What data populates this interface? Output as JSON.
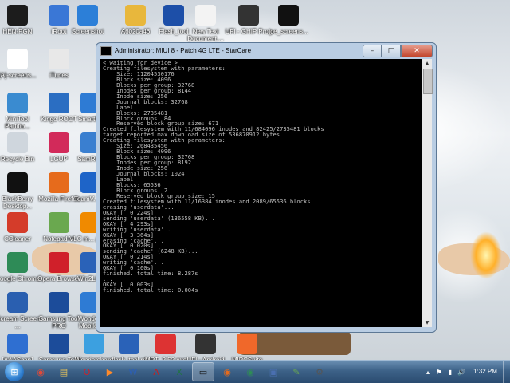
{
  "desktop_icons": [
    {
      "label": "HEN-PGN",
      "icon": "mobile-app-icon",
      "color": "#1c1c1c"
    },
    {
      "label": "iRoot",
      "icon": "root-app-icon",
      "color": "#3a77d6"
    },
    {
      "label": "Screenshot",
      "icon": "screenshot-icon",
      "color": "#2c7fd8"
    },
    {
      "label": "A6020a46",
      "icon": "folder-icon",
      "color": "#e8b73c"
    },
    {
      "label": "Flash_tool",
      "icon": "flash-tool-icon",
      "color": "#1d4fa8"
    },
    {
      "label": "New Text Document....",
      "icon": "text-document-icon",
      "color": "#f3f3f3"
    },
    {
      "label": "UFI - GHIP Prog",
      "icon": "ufi-icon",
      "color": "#333333"
    },
    {
      "label": "ice_screens...",
      "icon": "ice-screen-icon",
      "color": "#111111"
    },
    {
      "label": "[A]-screens...",
      "icon": "screenshot-file-icon",
      "color": "#ffffff"
    },
    {
      "label": "iTunes",
      "icon": "itunes-icon",
      "color": "#e8e8e8"
    },
    {
      "label": "MiniTool Partitio...",
      "icon": "minitool-icon",
      "color": "#3a8bd0"
    },
    {
      "label": "Kingo ROOT",
      "icon": "kingo-root-icon",
      "color": "#2b6ec2"
    },
    {
      "label": "SmartF...",
      "icon": "smartf-icon",
      "color": "#2e7bd4"
    },
    {
      "label": "Recycle Bin",
      "icon": "recycle-bin-icon",
      "color": "#cfd6dd"
    },
    {
      "label": "LGUP",
      "icon": "lgup-icon",
      "color": "#d22a5a"
    },
    {
      "label": "SamRe...",
      "icon": "samre-icon",
      "color": "#3a7fd0"
    },
    {
      "label": "BlackBerry Desktop...",
      "icon": "blackberry-icon",
      "color": "#111111"
    },
    {
      "label": "Mozilla Firefox",
      "icon": "firefox-icon",
      "color": "#e66b1c"
    },
    {
      "label": "TeamV... 12",
      "icon": "teamviewer-icon",
      "color": "#1e64c8"
    },
    {
      "label": "CCleaner",
      "icon": "ccleaner-icon",
      "color": "#d43c2a"
    },
    {
      "label": "Notepad++",
      "icon": "notepad-plus-icon",
      "color": "#6aa84f"
    },
    {
      "label": "VLC m... play...",
      "icon": "vlc-icon",
      "color": "#f08a00"
    },
    {
      "label": "Google Chrome",
      "icon": "chrome-icon",
      "color": "#2e8b57"
    },
    {
      "label": "Opera Browser",
      "icon": "opera-icon",
      "color": "#d0202a"
    },
    {
      "label": "Win2Lb...",
      "icon": "win2lb-icon",
      "color": "#2a62b8"
    },
    {
      "label": "iScream Screen ...",
      "icon": "screen-recorder-icon",
      "color": "#2a5fb0"
    },
    {
      "label": "Samsung Tool PRO",
      "icon": "samsung-tool-pro-icon",
      "color": "#1c4c9a"
    },
    {
      "label": "Wonde... Mobile...",
      "icon": "wondershare-mobile-icon",
      "color": "#2e7bd4"
    },
    {
      "label": "[AAAScan]",
      "icon": "scan-icon",
      "color": "#2f6fd1"
    },
    {
      "label": "Samsung Tool",
      "icon": "samsung-tool-icon",
      "color": "#1c4c9a"
    },
    {
      "label": "Wondershare TunesGo",
      "icon": "tunesgo-icon",
      "color": "#3ca0e0"
    },
    {
      "label": "flash_tool.rd",
      "icon": "flash-file-icon",
      "color": "#2a62b8"
    },
    {
      "label": "MRT_2.52.exe",
      "icon": "mrt-icon",
      "color": "#d33"
    },
    {
      "label": "UFI - Android ToolBox",
      "icon": "ufi-toolbox-icon",
      "color": "#333333"
    },
    {
      "label": "MIPCSuite",
      "icon": "mipcsuite-icon",
      "color": "#f0682a"
    }
  ],
  "cmd_window": {
    "title": "Administrator: MIUI 8 - Patch 4G LTE - StarCare",
    "min": "–",
    "max": "□",
    "close": "✕",
    "output": "< waiting for device >\nCreating filesystem with parameters:\n    Size: 11204530176\n    Block size: 4096\n    Blocks per group: 32768\n    Inodes per group: 8144\n    Inode size: 256\n    Journal blocks: 32768\n    Label:\n    Blocks: 2735481\n    Block groups: 84\n    Reserved block group size: 671\nCreated filesystem with 11/684096 inodes and 82425/2735481 blocks\ntarget reported max download size of 536870912 bytes\nCreating filesystem with parameters:\n    Size: 268435456\n    Block size: 4096\n    Blocks per group: 32768\n    Inodes per group: 8192\n    Inode size: 256\n    Journal blocks: 1024\n    Label:\n    Blocks: 65536\n    Block groups: 2\n    Reserved block group size: 15\nCreated filesystem with 11/16384 inodes and 2089/65536 blocks\nerasing 'userdata'...\nOKAY [  0.224s]\nsending 'userdata' (136558 KB)...\nOKAY [  4.293s]\nwriting 'userdata'...\nOKAY [  3.364s]\nerasing 'cache'...\nOKAY [  0.020s]\nsending 'cache' (6248 KB)...\nOKAY [  0.214s]\nwriting 'cache'...\nOKAY [  0.160s]\nfinished. total time: 8.287s\n...\nOKAY [  0.003s]\nfinished. total time: 0.004s"
  },
  "taskbar": {
    "start_icon": "windows-start-icon",
    "items": [
      {
        "icon": "chrome-taskbar-icon",
        "glyph": "◉",
        "color": "#e04a3a",
        "active": false
      },
      {
        "icon": "explorer-taskbar-icon",
        "glyph": "▤",
        "color": "#e9c45a",
        "active": false
      },
      {
        "icon": "opera-taskbar-icon",
        "glyph": "O",
        "color": "#d0202a",
        "active": false
      },
      {
        "icon": "media-taskbar-icon",
        "glyph": "▶",
        "color": "#ff8a2a",
        "active": false
      },
      {
        "icon": "word-taskbar-icon",
        "glyph": "W",
        "color": "#2b5fb8",
        "active": false
      },
      {
        "icon": "acrobat-taskbar-icon",
        "glyph": "A",
        "color": "#c81e1e",
        "active": false
      },
      {
        "icon": "excel-taskbar-icon",
        "glyph": "X",
        "color": "#217346",
        "active": false
      },
      {
        "icon": "cmd-taskbar-icon",
        "glyph": "▭",
        "color": "#111111",
        "active": true
      },
      {
        "icon": "firefox-taskbar-icon",
        "glyph": "◉",
        "color": "#e66b1c",
        "active": false
      },
      {
        "icon": "chrome-taskbar-icon-2",
        "glyph": "◉",
        "color": "#2e8b57",
        "active": false
      },
      {
        "icon": "app-taskbar-icon",
        "glyph": "▣",
        "color": "#4a6fb0",
        "active": false
      },
      {
        "icon": "notepad-taskbar-icon",
        "glyph": "✎",
        "color": "#6aa84f",
        "active": false
      },
      {
        "icon": "tool-taskbar-icon",
        "glyph": "⚙",
        "color": "#555555",
        "active": false
      }
    ],
    "tray_icons": [
      "▴",
      "⚑",
      "▮",
      "🔊"
    ],
    "clock_time": "1:32 PM",
    "clock_date": ""
  }
}
